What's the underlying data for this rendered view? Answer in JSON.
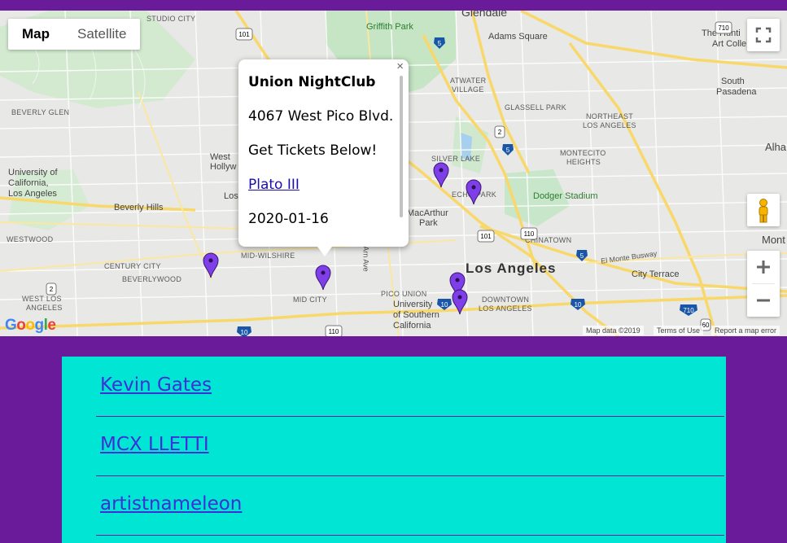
{
  "map": {
    "type_controls": [
      {
        "label": "Map",
        "active": true
      },
      {
        "label": "Satellite",
        "active": false
      }
    ],
    "labels": {
      "studio_city": "STUDIO CITY",
      "griffith_park": "Griffith Park",
      "glendale": "Glendale",
      "adams_square": "Adams Square",
      "huntington_1": "The Hunti",
      "huntington_2": "Art Colle",
      "south_pasadena_1": "South",
      "south_pasadena_2": "Pasadena",
      "beverly_glen": "BEVERLY GLEN",
      "atwater_1": "ATWATER",
      "atwater_2": "VILLAGE",
      "glassell": "GLASSELL PARK",
      "northeast_1": "NORTHEAST",
      "northeast_2": "LOS ANGELES",
      "montecito_1": "MONTECITO",
      "montecito_2": "HEIGHTS",
      "alhambra": "Alha",
      "ucla_1": "University of",
      "ucla_2": "California,",
      "ucla_3": "Los Angeles",
      "west_hollywood": "West",
      "west_hollywood_2": "Hollyw",
      "silver_lake": "SILVER LAKE",
      "echo_park": "ECHO PARK",
      "dodger_stadium": "Dodger Stadium",
      "beverly_hills": "Beverly Hills",
      "westwood": "WESTWOOD",
      "los_label": "Los",
      "macarthur_1": "MacArthur",
      "macarthur_2": "Park",
      "chinatown": "CHINATOWN",
      "monterey": "Mont",
      "century_city": "CENTURY CITY",
      "beverlywood": "BEVERLYWOOD",
      "mid_wilshire": "MID-WILSHIRE",
      "el_monte": "El Monte Busway",
      "los_angeles": "Los Angeles",
      "city_terrace": "City Terrace",
      "west_la_1": "WEST LOS",
      "west_la_2": "ANGELES",
      "pico_union": "PICO UNION",
      "mid_city": "MID CITY",
      "usc_1": "University",
      "usc_2": "of Southern",
      "usc_3": "California",
      "downtown_1": "DOWNTOWN",
      "downtown_2": "LOS ANGELES",
      "lond_ave": "Arn Ave",
      "shield_101a": "101",
      "shield_101b": "101",
      "shield_5a": "5",
      "shield_5b": "5",
      "shield_5c": "5",
      "shield_2a": "2",
      "shield_2b": "2",
      "shield_110": "110",
      "shield_710a": "710",
      "shield_710b": "710",
      "shield_10a": "10",
      "shield_10b": "10",
      "shield_10c": "10",
      "shield_60": "60",
      "shield_110b": "110"
    },
    "google_logo": "Google",
    "attribution": {
      "map_data": "Map data ©2019",
      "terms": "Terms of Use",
      "report": "Report a map error"
    },
    "markers": [
      {
        "name": "marker-1",
        "color": "#7e3fe8"
      },
      {
        "name": "marker-2",
        "color": "#7e3fe8"
      },
      {
        "name": "marker-3",
        "color": "#7e3fe8"
      },
      {
        "name": "marker-4",
        "color": "#7e3fe8"
      },
      {
        "name": "marker-5",
        "color": "#7e3fe8"
      },
      {
        "name": "marker-6",
        "color": "#7e3fe8"
      }
    ],
    "info_window": {
      "title": "Union NightClub",
      "address": "4067 West Pico Blvd.",
      "tickets_text": "Get Tickets Below!",
      "link_text": "Plato III",
      "date": "2020-01-16",
      "close_symbol": "×"
    },
    "controls": {
      "fullscreen_icon": "fullscreen-icon",
      "pegman_icon": "pegman-icon",
      "zoom_in": "+",
      "zoom_out": "−"
    }
  },
  "artists": [
    {
      "label": "Kevin Gates"
    },
    {
      "label": "MCX LLETTI"
    },
    {
      "label": "artistnameleon"
    }
  ],
  "colors": {
    "page_bg": "#6a1b9a",
    "list_bg": "#00e5d4",
    "link": "#3f2fd4",
    "marker": "#7e3fe8"
  }
}
